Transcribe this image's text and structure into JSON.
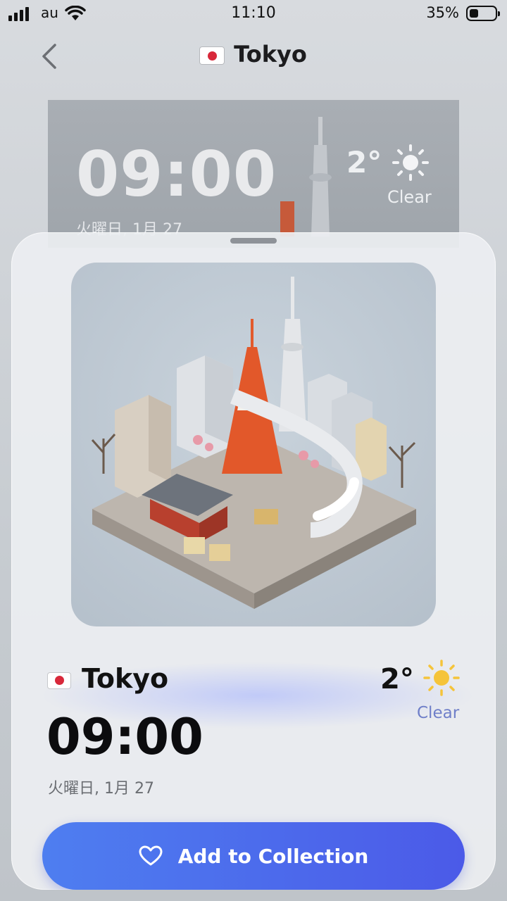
{
  "status_bar": {
    "carrier": "au",
    "time": "11:10",
    "battery_percent": "35%",
    "battery_level": 0.35
  },
  "nav": {
    "title": "Tokyo"
  },
  "preview": {
    "time": "09:00",
    "temperature": "2°",
    "condition": "Clear",
    "date": "火曜日, 1月 27"
  },
  "sheet": {
    "city": "Tokyo",
    "temperature": "2°",
    "condition": "Clear",
    "time": "09:00",
    "date": "火曜日, 1月 27",
    "cta_label": "Add to Collection",
    "icons": {
      "back": "chevron-left-icon",
      "weather": "sun-icon",
      "cta": "heart-icon",
      "flag": "japan-flag-icon"
    }
  },
  "colors": {
    "accent": "#4b5ae8",
    "sun": "#f5c43a",
    "flag_red": "#d8283a",
    "condition_text": "#6f7fc9"
  }
}
